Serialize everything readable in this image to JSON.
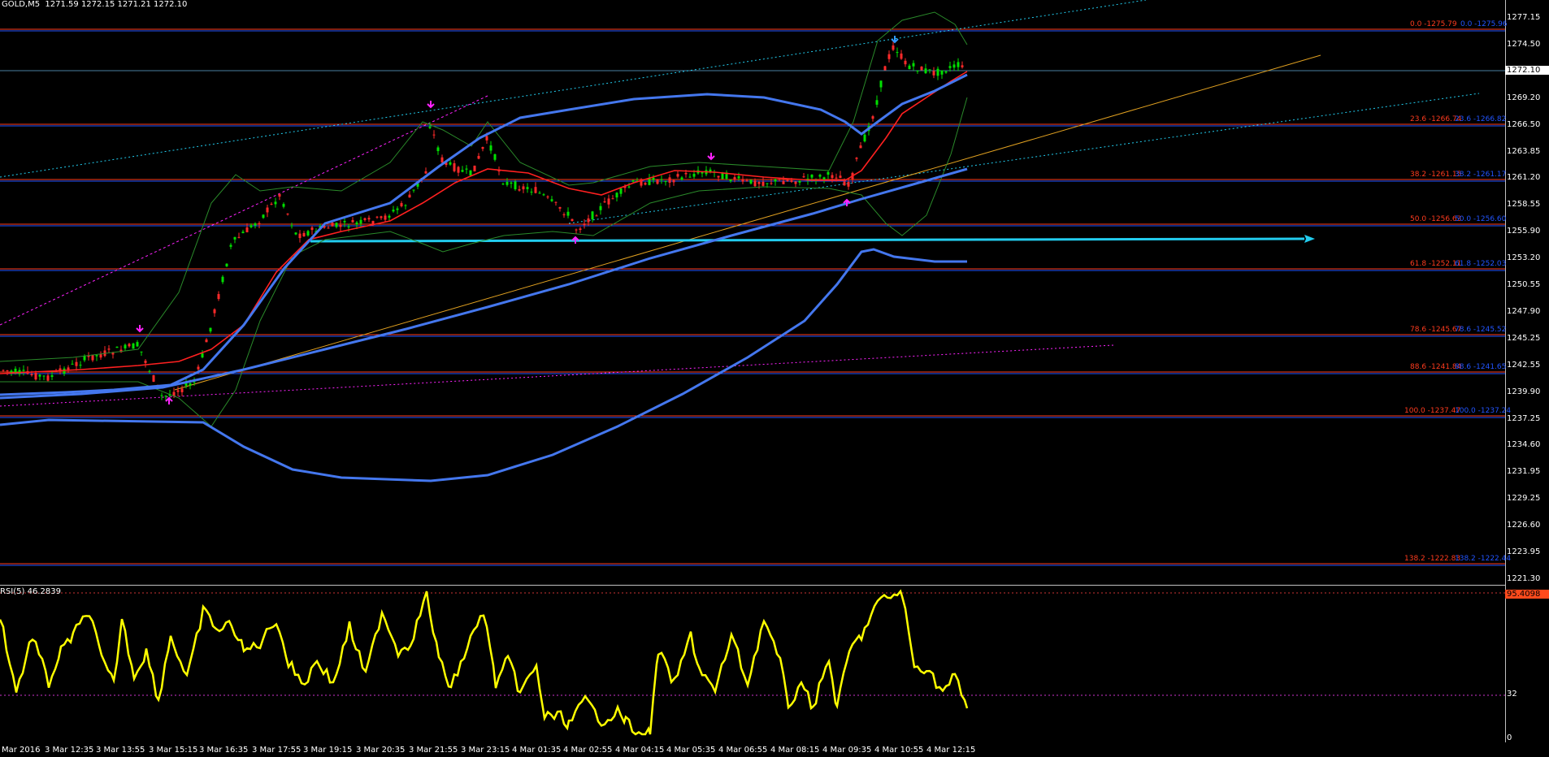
{
  "symbol_header": "GOLD,M5  1271.59 1272.15 1271.21 1272.10",
  "rsi_header": "RSI(5) 46.2839",
  "colors": {
    "background": "#000000",
    "bull": "#00e000",
    "bear": "#ff2a2a",
    "ma_red": "#ff2020",
    "ma_blue": "#4477ee",
    "bands": "#2a8a2a",
    "fib_red": "#ff3b1e",
    "fib_blue": "#2255ff",
    "rsi": "#ffff00",
    "horizontal": "#22ccee"
  },
  "price_axis": [
    "1277.15",
    "1274.50",
    "1272.10",
    "1269.20",
    "1266.50",
    "1263.85",
    "1261.20",
    "1258.55",
    "1255.90",
    "1253.20",
    "1250.55",
    "1247.90",
    "1245.25",
    "1242.55",
    "1239.90",
    "1237.25",
    "1234.60",
    "1231.95",
    "1229.25",
    "1226.60",
    "1223.95",
    "1221.30"
  ],
  "current_price": "1272.10",
  "rsi_axis": {
    "top": "95.4098",
    "low": "32",
    "zero": "0"
  },
  "time_axis": [
    "Mar 2016",
    "3 Mar 12:35",
    "3 Mar 13:55",
    "3 Mar 15:15",
    "3 Mar 16:35",
    "3 Mar 17:55",
    "3 Mar 19:15",
    "3 Mar 20:35",
    "3 Mar 21:55",
    "3 Mar 23:15",
    "4 Mar 01:35",
    "4 Mar 02:55",
    "4 Mar 04:15",
    "4 Mar 05:35",
    "4 Mar 06:55",
    "4 Mar 08:15",
    "4 Mar 09:35",
    "4 Mar 10:55",
    "4 Mar 12:15"
  ],
  "fib_levels": [
    {
      "pct": "0.0",
      "red": "0.0 -1275.79",
      "blue": "0.0 -1275.96"
    },
    {
      "pct": "23.6",
      "red": "23.6 -1266.74",
      "blue": "23.6 -1266.82"
    },
    {
      "pct": "38.2",
      "red": "38.2 -1261.15",
      "blue": "38.2 -1261.17"
    },
    {
      "pct": "50.0",
      "red": "50.0 -1256.63",
      "blue": "50.0 -1256.60"
    },
    {
      "pct": "61.8",
      "red": "61.8 -1252.11",
      "blue": "61.8 -1252.03"
    },
    {
      "pct": "78.6",
      "red": "78.6 -1245.67",
      "blue": "78.6 -1245.52"
    },
    {
      "pct": "88.6",
      "red": "88.6 -1241.84",
      "blue": "88.6 -1241.65"
    },
    {
      "pct": "100.0",
      "red": "100.0 -1237.47",
      "blue": "100.0 -1237.24"
    },
    {
      "pct": "138.2",
      "red": "138.2 -1222.83",
      "blue": "138.2 -1222.44"
    }
  ]
}
